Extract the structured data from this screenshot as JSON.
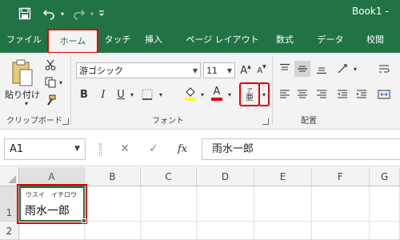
{
  "titlebar": {
    "title": "Book1 -",
    "save_icon": "save-icon",
    "undo_icon": "undo-icon",
    "redo_icon": "redo-icon",
    "customize_icon": "customize-qat-icon"
  },
  "tabs": [
    {
      "label": "ファイル"
    },
    {
      "label": "ホーム"
    },
    {
      "label": "タッチ"
    },
    {
      "label": "挿入"
    },
    {
      "label": "ページ レイアウト"
    },
    {
      "label": "数式"
    },
    {
      "label": "データ"
    },
    {
      "label": "校閲"
    }
  ],
  "ribbon": {
    "clipboard": {
      "paste_label": "貼り付け",
      "group_label": "クリップボード"
    },
    "font": {
      "font_name": "游ゴシック",
      "font_size": "11",
      "bold": "B",
      "italic": "I",
      "underline": "U",
      "font_color_letter": "A",
      "grow_letter": "A",
      "shrink_letter": "A",
      "phonetic_top": "ア",
      "phonetic_bottom": "亜",
      "group_label": "フォント"
    },
    "alignment": {
      "group_label": "配置"
    }
  },
  "formula_bar": {
    "name_box": "A1",
    "cancel_symbol": "✕",
    "enter_symbol": "✓",
    "fx_symbol": "fx",
    "content": "雨水一郎"
  },
  "sheet": {
    "columns": [
      "A",
      "B",
      "C",
      "D",
      "E",
      "F",
      "G"
    ],
    "rows": [
      "1",
      "2"
    ],
    "a1_furigana": "ウスイ　イチロウ",
    "a1_value": "雨水一郎"
  },
  "colors": {
    "accent": "#217346",
    "highlight": "#e00000",
    "font_color_bar": "#e00000",
    "fill_color_bar": "#ffff00"
  }
}
